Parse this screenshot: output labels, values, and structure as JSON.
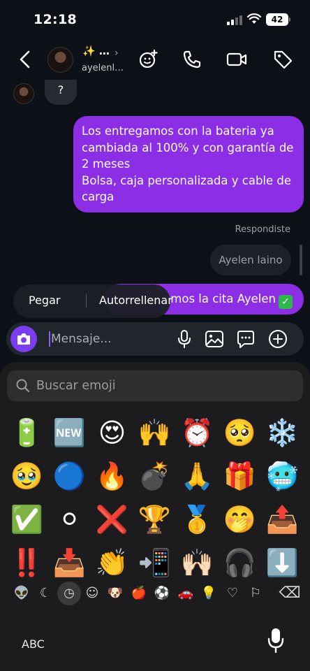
{
  "status_bar": {
    "time": "12:18",
    "battery": "42"
  },
  "header": {
    "title": "✨ …",
    "subtitle": "ayelenl…"
  },
  "chat": {
    "incoming_text": "?",
    "outgoing_lines": [
      "Los entregamos con la bateria ya cambiada al 100% y con garantía de 2 meses",
      "Bolsa, caja personalizada y cable de carga"
    ],
    "replied_label": "Respondiste",
    "reply_quote": "Ayelen laino",
    "outgoing_2": "…amos la cita Ayelen",
    "popup": {
      "paste": "Pegar",
      "autofill": "Autorrellenar"
    }
  },
  "composer": {
    "placeholder": "Mensaje..."
  },
  "keyboard": {
    "search_placeholder": "Buscar emoji",
    "emoji_rows": [
      [
        "🔋",
        "🆕",
        "😍",
        "🙌",
        "⏰",
        "🥺",
        "❄️"
      ],
      [
        "🥹",
        "🔵",
        "🔥",
        "💣",
        "🙏",
        "🎁",
        "🥶"
      ],
      [
        "✅",
        "⚪",
        "❌",
        "🏆",
        "🥇",
        "🤭",
        "📤"
      ],
      [
        "‼️",
        "📥",
        "👏",
        "📲",
        "🙌🏻",
        "🎧",
        "⬇️"
      ]
    ],
    "categories": [
      "👽",
      "☾",
      "◷",
      "☺",
      "🐶",
      "🍎",
      "⚽",
      "🚗",
      "💡",
      "♡",
      "⚐",
      "⌫"
    ],
    "abc_label": "ABC"
  }
}
